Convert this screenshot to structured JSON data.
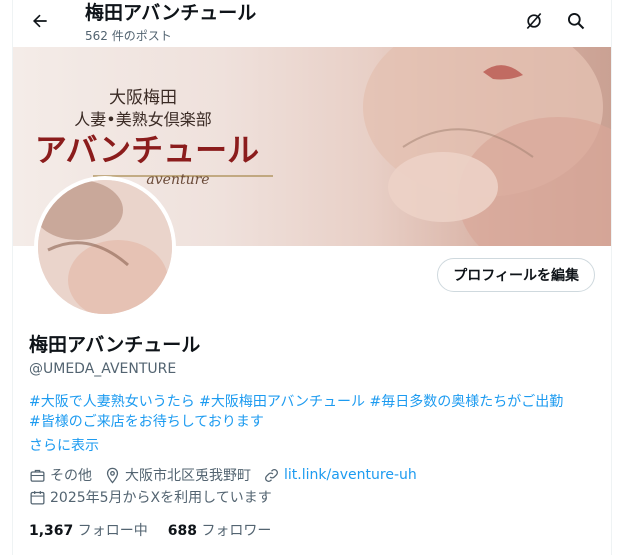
{
  "header": {
    "title": "梅田アバンチュール",
    "post_count": "562 件のポスト"
  },
  "icons": {
    "back": "arrow-left-icon",
    "hide": "eye-off-icon",
    "search": "search-icon"
  },
  "banner": {
    "line1": "大阪梅田",
    "line2": "人妻•美熟女倶楽部",
    "brand": "アバンチュール",
    "brand_sub": "aventure",
    "brand_color": "#8b1c1c"
  },
  "profile": {
    "edit_button": "プロフィールを編集",
    "name": "梅田アバンチュール",
    "handle": "@UMEDA_AVENTURE",
    "bio_line1": "#大阪で人妻熟女いうたら #大阪梅田アバンチュール #毎日多数の奥様たちがご出勤",
    "bio_line2": "#皆様のご来店をお待ちしております",
    "show_more": "さらに表示",
    "category": "その他",
    "location": "大阪市北区兎我野町",
    "link": "lit.link/aventure-uh",
    "joined": "2025年5月からXを利用しています",
    "following_count": "1,367",
    "following_label": "フォロー中",
    "followers_count": "688",
    "followers_label": "フォロワー"
  },
  "colors": {
    "accent": "#1d9bf0",
    "secondary_text": "#536471"
  }
}
